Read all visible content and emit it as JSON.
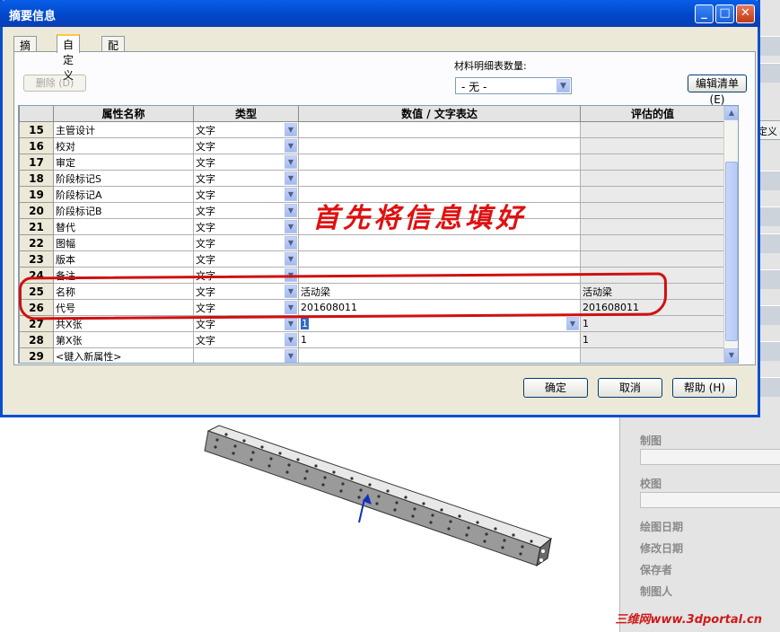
{
  "window": {
    "title": "摘要信息",
    "minimize": "_",
    "maximize": "□",
    "close": "✕"
  },
  "tabs": [
    {
      "label": "摘要"
    },
    {
      "label": "自定义"
    },
    {
      "label": "配置特定"
    }
  ],
  "toolbar": {
    "delete_label": "删除 (D)",
    "bom_quantity_label": "材料明细表数量:",
    "bom_quantity_value": "- 无 -",
    "edit_list_label": "编辑清单 (E)"
  },
  "grid": {
    "headers": [
      "属性名称",
      "类型",
      "数值 / 文字表达",
      "评估的值"
    ],
    "rows": [
      {
        "num": "15",
        "name": "主管设计",
        "type": "文字",
        "value": "",
        "eval": ""
      },
      {
        "num": "16",
        "name": "校对",
        "type": "文字",
        "value": "",
        "eval": ""
      },
      {
        "num": "17",
        "name": "审定",
        "type": "文字",
        "value": "",
        "eval": ""
      },
      {
        "num": "18",
        "name": "阶段标记S",
        "type": "文字",
        "value": "",
        "eval": ""
      },
      {
        "num": "19",
        "name": "阶段标记A",
        "type": "文字",
        "value": "",
        "eval": ""
      },
      {
        "num": "20",
        "name": "阶段标记B",
        "type": "文字",
        "value": "",
        "eval": ""
      },
      {
        "num": "21",
        "name": "替代",
        "type": "文字",
        "value": "",
        "eval": ""
      },
      {
        "num": "22",
        "name": "图幅",
        "type": "文字",
        "value": "",
        "eval": ""
      },
      {
        "num": "23",
        "name": "版本",
        "type": "文字",
        "value": "",
        "eval": ""
      },
      {
        "num": "24",
        "name": "备注",
        "type": "文字",
        "value": "",
        "eval": ""
      },
      {
        "num": "25",
        "name": "名称",
        "type": "文字",
        "value": "活动梁",
        "eval": "活动梁"
      },
      {
        "num": "26",
        "name": "代号",
        "type": "文字",
        "value": "201608011",
        "eval": "201608011"
      },
      {
        "num": "27",
        "name": "共X张",
        "type": "文字",
        "value": "1",
        "eval": "1"
      },
      {
        "num": "28",
        "name": "第X张",
        "type": "文字",
        "value": "1",
        "eval": "1"
      },
      {
        "num": "29",
        "name": "<键入新属性>",
        "type": "",
        "value": "",
        "eval": ""
      }
    ]
  },
  "annotation": {
    "text": "首先将信息填好"
  },
  "buttons": {
    "ok": "确定",
    "cancel": "取消",
    "help": "帮助 (H)"
  },
  "right_panel": {
    "header": "定义",
    "labels": [
      "制图",
      "校图",
      "绘图日期",
      "修改日期",
      "保存者",
      "制图人"
    ]
  },
  "watermark": "三维网www.3dportal.cn",
  "colors": {
    "titlebar": "#0a4fd0",
    "annotation": "#e01010",
    "selection": "#316ac5"
  }
}
